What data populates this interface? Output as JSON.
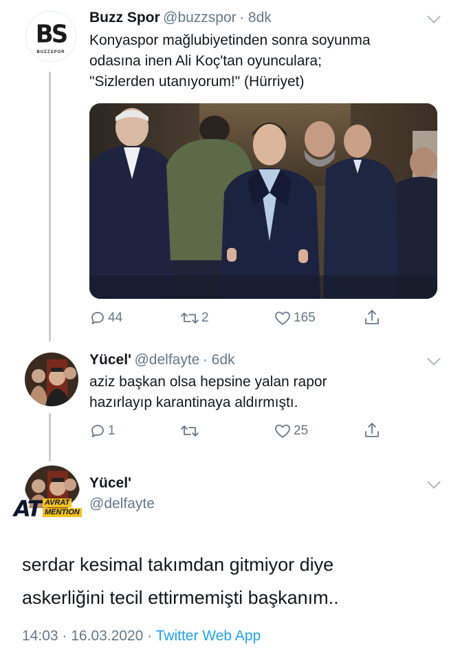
{
  "tweet1": {
    "name": "Buzz Spor",
    "handle": "@buzzspor",
    "time": "· 8dk",
    "logo_text": "BS",
    "logo_sub": "BUZZSPOR",
    "lines": [
      "Konyaspor mağlubiyetinden sonra soyunma",
      "odasına inen Ali Koç'tan oyunculara;",
      "\"Sizlerden utanıyorum!\" (Hürriyet)"
    ],
    "replies": "44",
    "retweets": "2",
    "likes": "165"
  },
  "tweet2": {
    "name": "Yücel'",
    "handle": "@delfayte",
    "time": "· 6dk",
    "lines": [
      "aziz başkan olsa hepsine yalan rapor",
      "hazırlayıp karantinaya aldırmıştı."
    ],
    "replies": "1",
    "retweets": "",
    "likes": "25"
  },
  "tweet3": {
    "name": "Yücel'",
    "handle": "@delfayte",
    "badge_big": "AT",
    "badge_top": "AVRAT",
    "badge_bottom": "MENTION",
    "lines": [
      "serdar kesimal takımdan gitmiyor diye",
      "askerliğini tecil ettirmemişti başkanım.."
    ],
    "timestamp": "14:03 · 16.03.2020 ·",
    "source": "Twitter Web App"
  },
  "icons": [
    "reply-icon",
    "retweet-icon",
    "like-icon",
    "share-icon",
    "chevron-down-icon"
  ],
  "colors": {
    "link": "#1da1f2",
    "muted": "#657786",
    "line": "#c4cfd6"
  }
}
